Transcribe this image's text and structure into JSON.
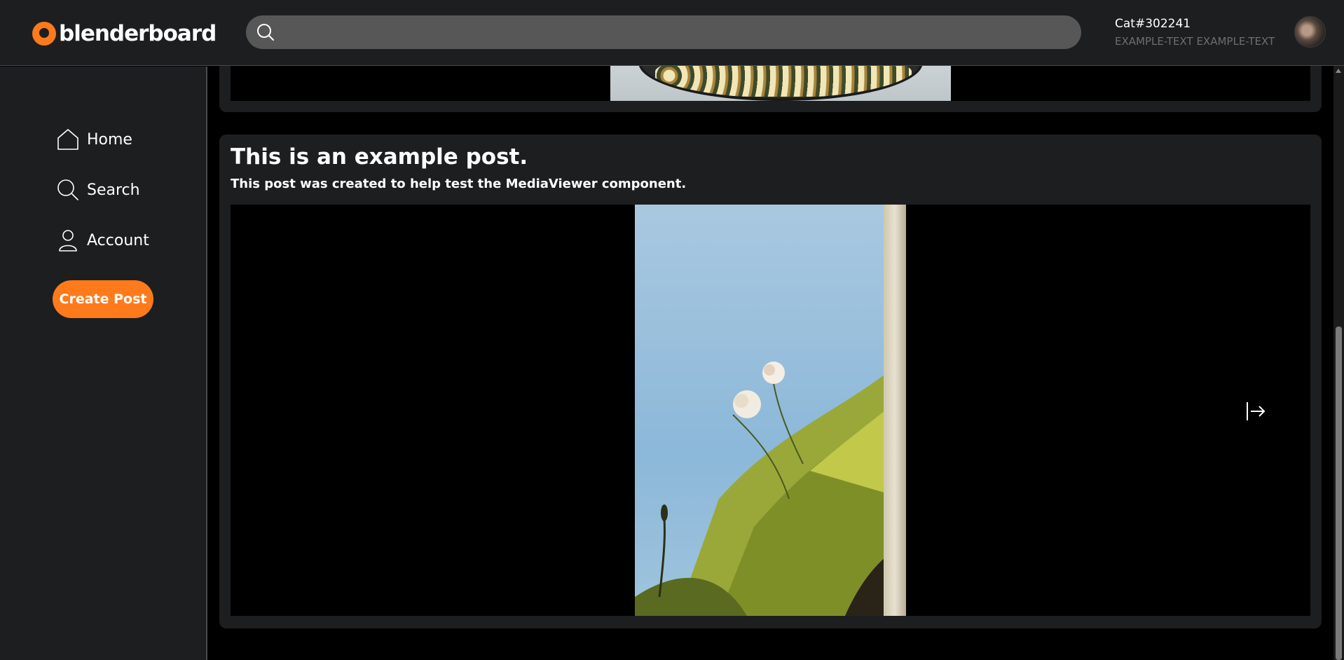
{
  "app": {
    "name": "blenderboard",
    "accent": "#ff7a1a"
  },
  "header": {
    "search_placeholder": "",
    "user": {
      "name": "Cat#302241",
      "subtitle": "EXAMPLE-TEXT EXAMPLE-TEXT"
    }
  },
  "sidebar": {
    "items": [
      {
        "label": "Home",
        "icon": "home-icon"
      },
      {
        "label": "Search",
        "icon": "search-icon"
      },
      {
        "label": "Account",
        "icon": "user-icon"
      }
    ],
    "create_label": "Create Post"
  },
  "post": {
    "title": "This is an example post.",
    "subtitle": "This post was created to help test the MediaViewer component.",
    "media_next_icon": "arrow-right-bar-icon"
  }
}
